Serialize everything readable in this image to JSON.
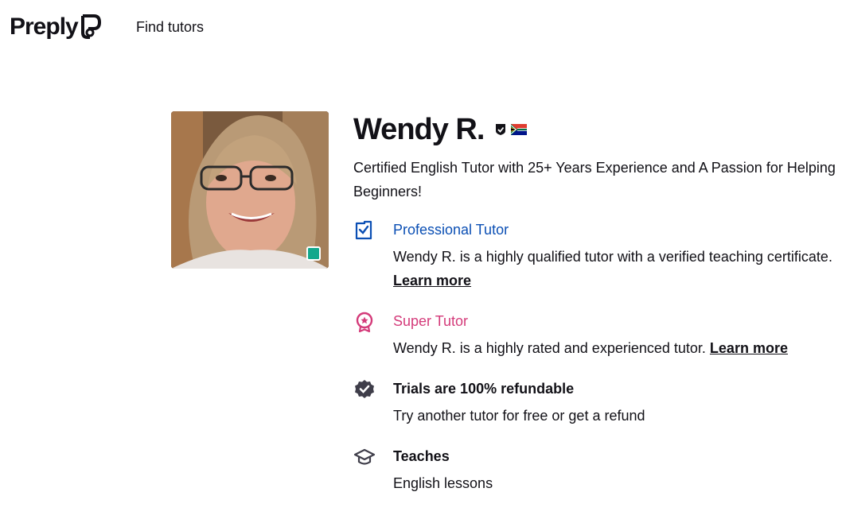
{
  "header": {
    "logo_text": "Preply",
    "nav_find_tutors": "Find tutors"
  },
  "tutor": {
    "name": "Wendy R.",
    "headline": "Certified English Tutor with 25+ Years Experience and A Passion for Helping Beginners!",
    "online": true,
    "country_flag": "south-africa-flag-icon"
  },
  "features": {
    "professional": {
      "title": "Professional Tutor",
      "desc": "Wendy R. is a highly qualified tutor with a verified teaching certificate.",
      "link": "Learn more",
      "color": "#0b4fb4",
      "icon": "certificate-check-icon"
    },
    "super": {
      "title": "Super Tutor",
      "desc": "Wendy R. is a highly rated and experienced tutor.",
      "link": "Learn more",
      "color": "#d43b7a",
      "icon": "award-star-icon"
    },
    "refund": {
      "title": "Trials are 100% refundable",
      "desc": "Try another tutor for free or get a refund",
      "icon": "shield-check-icon"
    },
    "teaches": {
      "title": "Teaches",
      "desc": "English lessons",
      "icon": "graduation-cap-icon"
    }
  },
  "colors": {
    "online": "#12a88c",
    "text": "#121117"
  }
}
